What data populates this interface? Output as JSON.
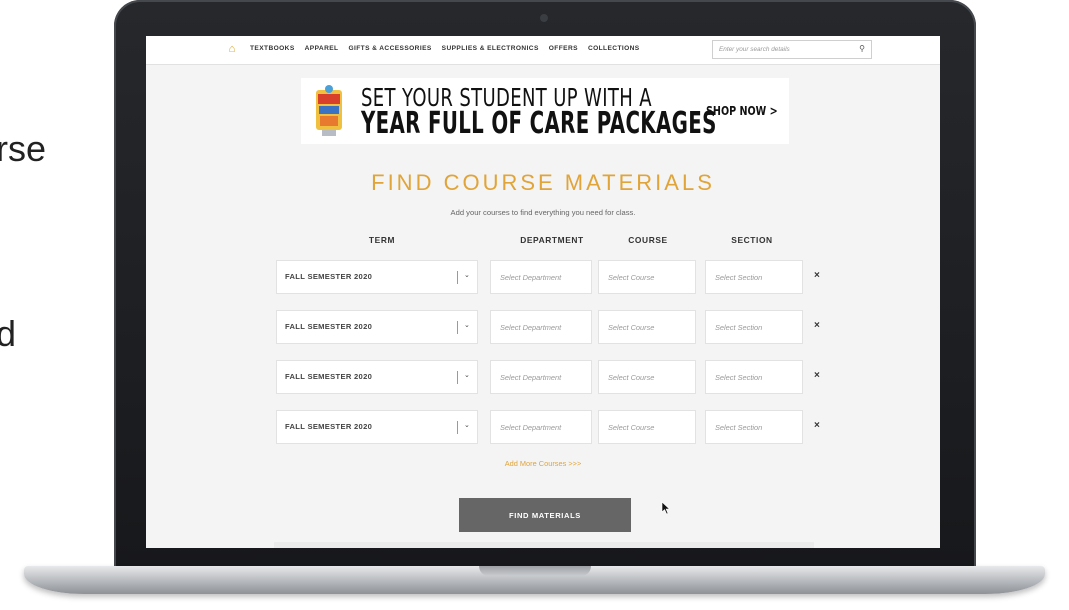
{
  "slide": {
    "fragment_1": "rse",
    "fragment_2": "d"
  },
  "nav": {
    "home_icon": "home-icon",
    "links": [
      "TEXTBOOKS",
      "APPAREL",
      "GIFTS & ACCESSORIES",
      "SUPPLIES & ELECTRONICS",
      "OFFERS",
      "COLLECTIONS"
    ],
    "search_placeholder": "Enter your search details",
    "search_icon": "search-icon"
  },
  "banner": {
    "line1": "SET YOUR STUDENT UP WITH A",
    "line2": "YEAR FULL OF CARE PACKAGES",
    "cta": "SHOP NOW >"
  },
  "finder": {
    "title": "FIND COURSE MATERIALS",
    "subtitle": "Add your courses to find everything you need for class.",
    "columns": {
      "term": "TERM",
      "department": "DEPARTMENT",
      "course": "COURSE",
      "section": "SECTION"
    },
    "rows": [
      {
        "term": "FALL SEMESTER 2020",
        "department": "Select Department",
        "course": "Select Course",
        "section": "Select Section"
      },
      {
        "term": "FALL SEMESTER 2020",
        "department": "Select Department",
        "course": "Select Course",
        "section": "Select Section"
      },
      {
        "term": "FALL SEMESTER 2020",
        "department": "Select Department",
        "course": "Select Course",
        "section": "Select Section"
      },
      {
        "term": "FALL SEMESTER 2020",
        "department": "Select Department",
        "course": "Select Course",
        "section": "Select Section"
      }
    ],
    "add_more": "Add More Courses >>>",
    "submit": "FIND MATERIALS"
  },
  "colors": {
    "accent": "#e0a438",
    "button": "#666666",
    "page_bg": "#f4f4f4"
  }
}
